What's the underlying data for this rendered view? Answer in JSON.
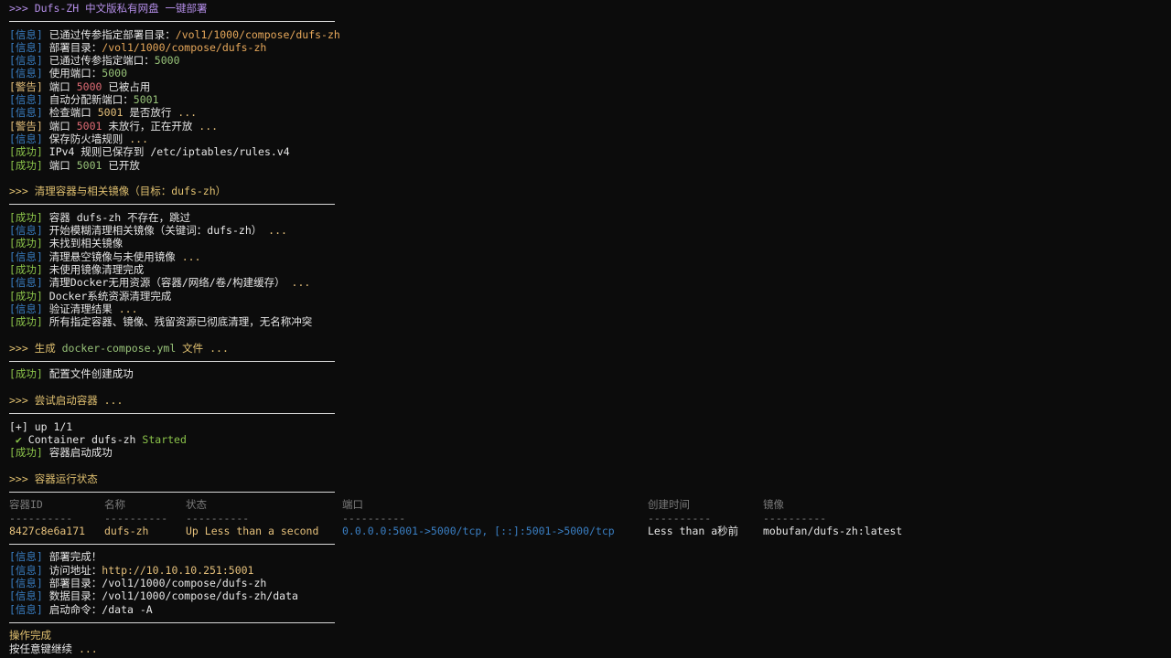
{
  "section1": {
    "header": ">>> Dufs-ZH 中文版私有网盘 一键部署",
    "lines": [
      {
        "tag": "[信息]",
        "type": "info",
        "text": " 已通过传参指定部署目录：",
        "value": "/vol1/1000/compose/dufs-zh",
        "vclass": "path"
      },
      {
        "tag": "[信息]",
        "type": "info",
        "text": " 部署目录：",
        "value": "/vol1/1000/compose/dufs-zh",
        "vclass": "path"
      },
      {
        "tag": "[信息]",
        "type": "info",
        "text": " 已通过传参指定端口：",
        "value": "5000",
        "vclass": "num"
      },
      {
        "tag": "[信息]",
        "type": "info",
        "text": " 使用端口：",
        "value": "5000",
        "vclass": "num"
      },
      {
        "tag": "[警告]",
        "type": "warn",
        "text": " 端口 ",
        "value": "5000",
        "vclass": "red",
        "suffix": " 已被占用"
      },
      {
        "tag": "[信息]",
        "type": "info",
        "text": " 自动分配新端口：",
        "value": "5001",
        "vclass": "num"
      },
      {
        "tag": "[信息]",
        "type": "info",
        "text": " 检查端口 ",
        "value": "5001",
        "vclass": "orange",
        "suffix": " 是否放行 ",
        "dots": "..."
      },
      {
        "tag": "[警告]",
        "type": "warn",
        "text": " 端口 ",
        "value": "5001",
        "vclass": "red",
        "suffix": " 未放行，正在开放 ",
        "dots": "..."
      },
      {
        "tag": "[信息]",
        "type": "info",
        "text": " 保存防火墙规则 ",
        "value": "",
        "vclass": "",
        "dots": "..."
      },
      {
        "tag": "[成功]",
        "type": "ok",
        "text": " IPv4 规则已保存到 /etc/iptables/rules.v4",
        "value": "",
        "vclass": ""
      },
      {
        "tag": "[成功]",
        "type": "ok",
        "text": " 端口 ",
        "value": "5001",
        "vclass": "num",
        "suffix": " 已开放"
      }
    ]
  },
  "section2": {
    "header": ">>> 清理容器与相关镜像（目标：dufs-zh）",
    "lines": [
      {
        "tag": "[成功]",
        "type": "ok",
        "text": " 容器 dufs-zh 不存在，跳过"
      },
      {
        "tag": "[信息]",
        "type": "info",
        "text": " 开始模糊清理相关镜像（关键词：dufs-zh） ",
        "dots": "..."
      },
      {
        "tag": "[成功]",
        "type": "ok",
        "text": " 未找到相关镜像"
      },
      {
        "tag": "[信息]",
        "type": "info",
        "text": " 清理悬空镜像与未使用镜像 ",
        "dots": "..."
      },
      {
        "tag": "[成功]",
        "type": "ok",
        "text": " 未使用镜像清理完成"
      },
      {
        "tag": "[信息]",
        "type": "info",
        "text": " 清理Docker无用资源（容器/网络/卷/构建缓存） ",
        "dots": "..."
      },
      {
        "tag": "[成功]",
        "type": "ok",
        "text": " Docker系统资源清理完成"
      },
      {
        "tag": "[信息]",
        "type": "info",
        "text": " 验证清理结果 ",
        "dots": "..."
      },
      {
        "tag": "[成功]",
        "type": "ok",
        "text": " 所有指定容器、镜像、残留资源已彻底清理，无名称冲突"
      }
    ]
  },
  "section3": {
    "header_prefix": ">>> 生成 ",
    "header_file": "docker-compose.yml",
    "header_suffix": " 文件 ...",
    "line": {
      "tag": "[成功]",
      "text": " 配置文件创建成功"
    }
  },
  "section4": {
    "header": ">>> 尝试启动容器 ...",
    "up_line": "[+] up 1/1",
    "check": " ✔",
    "container_text": " Container dufs-zh ",
    "started": "Started",
    "line": {
      "tag": "[成功]",
      "text": " 容器启动成功"
    }
  },
  "section5": {
    "header": ">>> 容器运行状态",
    "columns": [
      "容器ID",
      "名称",
      "状态",
      "端口",
      "创建时间",
      "镜像"
    ],
    "separators": [
      "----------",
      "----------",
      "----------",
      "----------",
      "----------",
      "----------"
    ],
    "row": [
      "8427c8e6a171",
      "dufs-zh",
      "Up Less than a second",
      "0.0.0.0:5001->5000/tcp, [::]:5001->5000/tcp",
      "Less than a秒前",
      "mobufan/dufs-zh:latest"
    ]
  },
  "section6": {
    "lines": [
      {
        "tag": "[信息]",
        "label": " 部署完成！",
        "value": ""
      },
      {
        "tag": "[信息]",
        "label": " 访问地址：",
        "value": "http://10.10.10.251:5001",
        "vclass": "orange"
      },
      {
        "tag": "[信息]",
        "label": " 部署目录：",
        "value": "/vol1/1000/compose/dufs-zh",
        "vclass": "white"
      },
      {
        "tag": "[信息]",
        "label": " 数据目录：",
        "value": "/vol1/1000/compose/dufs-zh/data",
        "vclass": "white"
      },
      {
        "tag": "[信息]",
        "label": " 启动命令：",
        "value": "/data -A",
        "vclass": "white"
      }
    ]
  },
  "footer": {
    "done": "操作完成",
    "press_prefix": "按任意键继续 ",
    "press_dots": "..."
  }
}
